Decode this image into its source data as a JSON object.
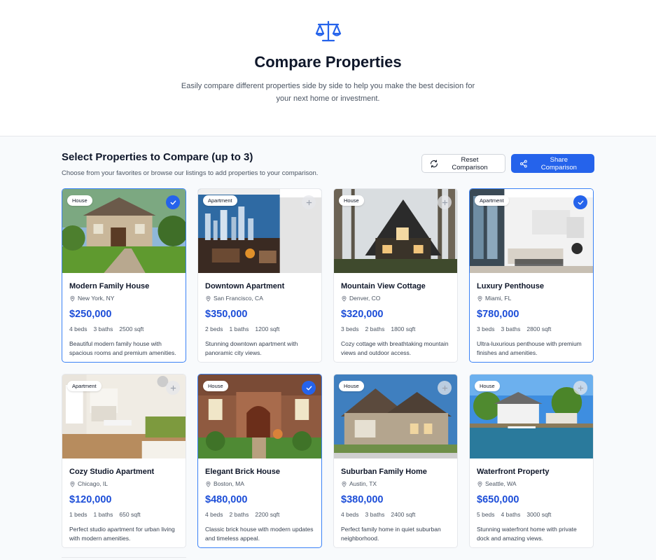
{
  "header": {
    "title": "Compare Properties",
    "subtitle": "Easily compare different properties side by side to help you make the best decision for your next home or investment.",
    "icon": "scale-icon"
  },
  "section": {
    "title": "Select Properties to Compare (up to 3)",
    "subtitle": "Choose from your favorites or browse our listings to add properties to your comparison.",
    "reset_label": "Reset Comparison",
    "share_label": "Share Comparison"
  },
  "colors": {
    "accent": "#2563eb",
    "price": "#1d4ed8"
  },
  "properties": [
    {
      "type": "House",
      "name": "Modern Family House",
      "location": "New York, NY",
      "price": "$250,000",
      "beds": "4 beds",
      "baths": "3 baths",
      "sqft": "2500 sqft",
      "description": "Beautiful modern family house with spacious rooms and premium amenities.",
      "selected": true
    },
    {
      "type": "Apartment",
      "name": "Downtown Apartment",
      "location": "San Francisco, CA",
      "price": "$350,000",
      "beds": "2 beds",
      "baths": "1 baths",
      "sqft": "1200 sqft",
      "description": "Stunning downtown apartment with panoramic city views.",
      "selected": false
    },
    {
      "type": "House",
      "name": "Mountain View Cottage",
      "location": "Denver, CO",
      "price": "$320,000",
      "beds": "3 beds",
      "baths": "2 baths",
      "sqft": "1800 sqft",
      "description": "Cozy cottage with breathtaking mountain views and outdoor access.",
      "selected": false
    },
    {
      "type": "Apartment",
      "name": "Luxury Penthouse",
      "location": "Miami, FL",
      "price": "$780,000",
      "beds": "3 beds",
      "baths": "3 baths",
      "sqft": "2800 sqft",
      "description": "Ultra-luxurious penthouse with premium finishes and amenities.",
      "selected": true
    },
    {
      "type": "Apartment",
      "name": "Cozy Studio Apartment",
      "location": "Chicago, IL",
      "price": "$120,000",
      "beds": "1 beds",
      "baths": "1 baths",
      "sqft": "650 sqft",
      "description": "Perfect studio apartment for urban living with modern amenities.",
      "selected": false
    },
    {
      "type": "House",
      "name": "Elegant Brick House",
      "location": "Boston, MA",
      "price": "$480,000",
      "beds": "4 beds",
      "baths": "2 baths",
      "sqft": "2200 sqft",
      "description": "Classic brick house with modern updates and timeless appeal.",
      "selected": true
    },
    {
      "type": "House",
      "name": "Suburban Family Home",
      "location": "Austin, TX",
      "price": "$380,000",
      "beds": "4 beds",
      "baths": "3 baths",
      "sqft": "2400 sqft",
      "description": "Perfect family home in quiet suburban neighborhood.",
      "selected": false
    },
    {
      "type": "House",
      "name": "Waterfront Property",
      "location": "Seattle, WA",
      "price": "$650,000",
      "beds": "5 beds",
      "baths": "4 baths",
      "sqft": "3000 sqft",
      "description": "Stunning waterfront home with private dock and amazing views.",
      "selected": false
    }
  ]
}
